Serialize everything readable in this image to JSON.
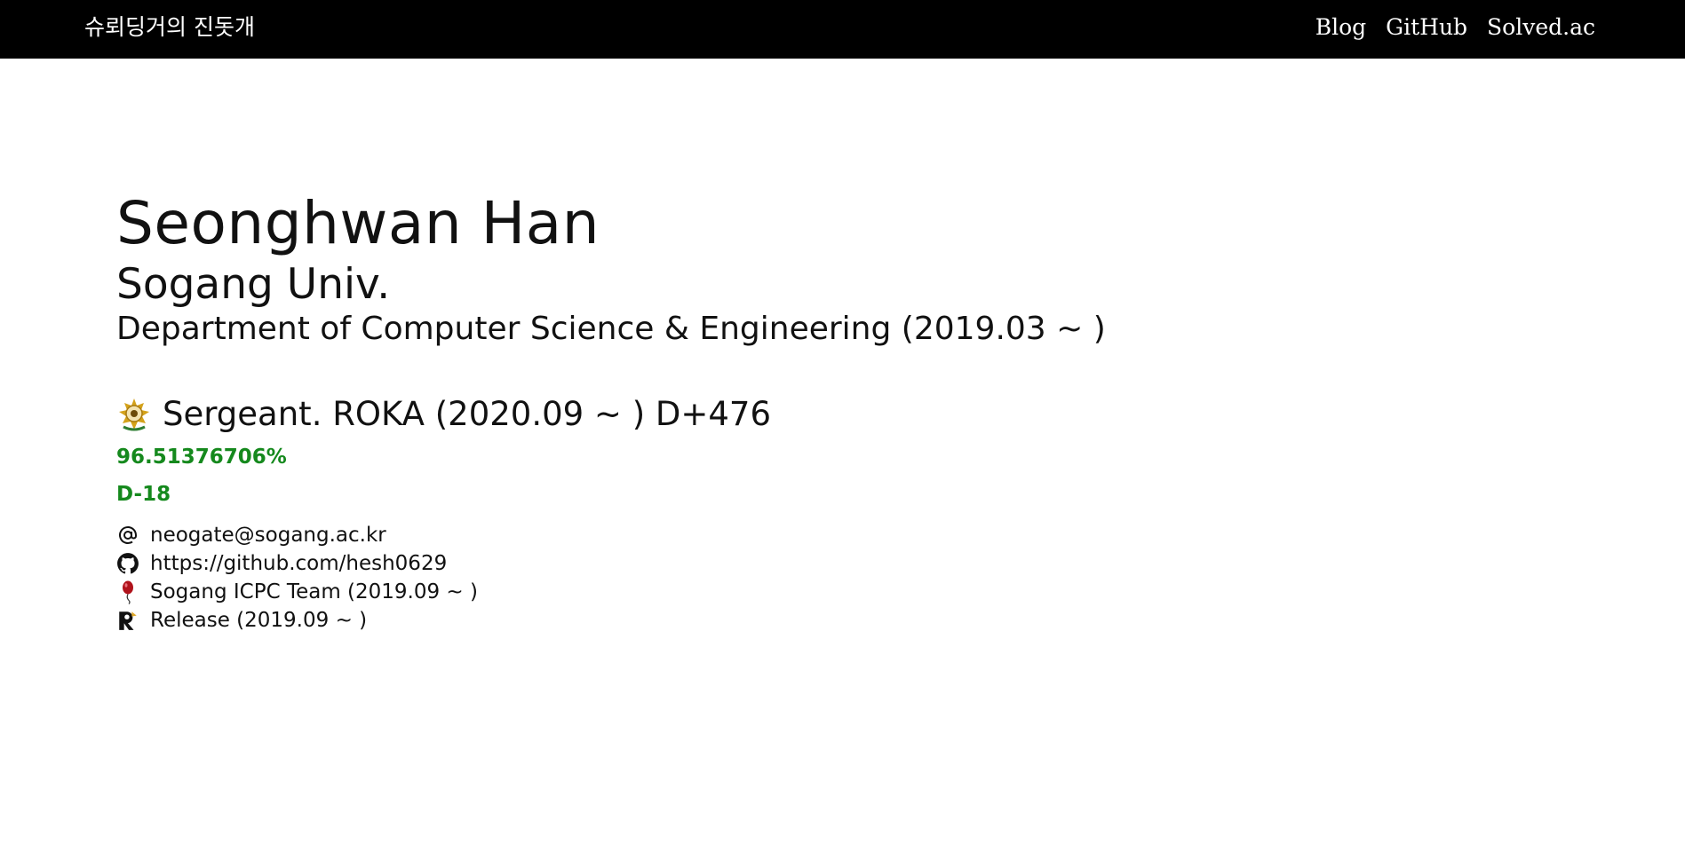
{
  "header": {
    "brand": "슈뢰딩거의 진돗개",
    "nav": [
      "Blog",
      "GitHub",
      "Solved.ac"
    ]
  },
  "profile": {
    "name": "Seonghwan Han",
    "university": "Sogang Univ.",
    "department": "Department of Computer Science & Engineering (2019.03 ~ )",
    "military": "Sergeant. ROKA (2020.09 ~ ) D+476",
    "service_progress": "96.51376706%",
    "dday": "D-18"
  },
  "contacts": [
    {
      "icon": "at-icon",
      "text": "neogate@sogang.ac.kr"
    },
    {
      "icon": "github-icon",
      "text": "https://github.com/hesh0629"
    },
    {
      "icon": "balloon-icon",
      "text": "Sogang ICPC Team (2019.09 ~ )"
    },
    {
      "icon": "release-logo-icon",
      "text": "Release (2019.09 ~ )"
    }
  ],
  "colors": {
    "topbar": "#000000",
    "accent_green": "#15891d",
    "balloon_red": "#b0121b",
    "emblem_gold": "#d4a21a"
  }
}
